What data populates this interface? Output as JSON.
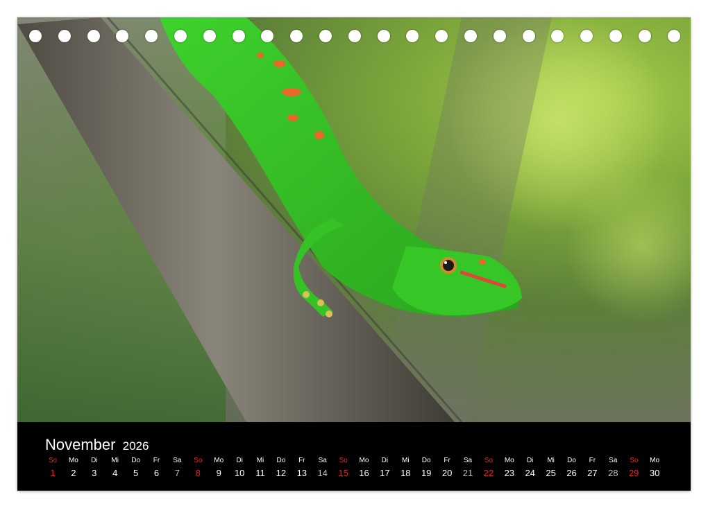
{
  "calendar": {
    "month": "November",
    "year": "2026",
    "days": [
      {
        "wd": "So",
        "n": "1",
        "kind": "sun"
      },
      {
        "wd": "Mo",
        "n": "2",
        "kind": "week"
      },
      {
        "wd": "Di",
        "n": "3",
        "kind": "week"
      },
      {
        "wd": "Mi",
        "n": "4",
        "kind": "week"
      },
      {
        "wd": "Do",
        "n": "5",
        "kind": "week"
      },
      {
        "wd": "Fr",
        "n": "6",
        "kind": "week"
      },
      {
        "wd": "Sa",
        "n": "7",
        "kind": "sat"
      },
      {
        "wd": "So",
        "n": "8",
        "kind": "sun"
      },
      {
        "wd": "Mo",
        "n": "9",
        "kind": "week"
      },
      {
        "wd": "Di",
        "n": "10",
        "kind": "week"
      },
      {
        "wd": "Mi",
        "n": "11",
        "kind": "week"
      },
      {
        "wd": "Do",
        "n": "12",
        "kind": "week"
      },
      {
        "wd": "Fr",
        "n": "13",
        "kind": "week"
      },
      {
        "wd": "Sa",
        "n": "14",
        "kind": "sat"
      },
      {
        "wd": "So",
        "n": "15",
        "kind": "sun"
      },
      {
        "wd": "Mo",
        "n": "16",
        "kind": "week"
      },
      {
        "wd": "Di",
        "n": "17",
        "kind": "week"
      },
      {
        "wd": "Mi",
        "n": "18",
        "kind": "week"
      },
      {
        "wd": "Do",
        "n": "19",
        "kind": "week"
      },
      {
        "wd": "Fr",
        "n": "20",
        "kind": "week"
      },
      {
        "wd": "Sa",
        "n": "21",
        "kind": "sat"
      },
      {
        "wd": "So",
        "n": "22",
        "kind": "sun"
      },
      {
        "wd": "Mo",
        "n": "23",
        "kind": "week"
      },
      {
        "wd": "Di",
        "n": "24",
        "kind": "week"
      },
      {
        "wd": "Mi",
        "n": "25",
        "kind": "week"
      },
      {
        "wd": "Do",
        "n": "26",
        "kind": "week"
      },
      {
        "wd": "Fr",
        "n": "27",
        "kind": "week"
      },
      {
        "wd": "Sa",
        "n": "28",
        "kind": "sat"
      },
      {
        "wd": "So",
        "n": "29",
        "kind": "sun"
      },
      {
        "wd": "Mo",
        "n": "30",
        "kind": "week"
      }
    ]
  },
  "photo": {
    "subject": "green-gecko-on-branch",
    "colors": {
      "gecko": "#3fbf2a",
      "spots": "#e8672a",
      "branch": "#6e6a60",
      "sunday": "#e0252b"
    }
  }
}
